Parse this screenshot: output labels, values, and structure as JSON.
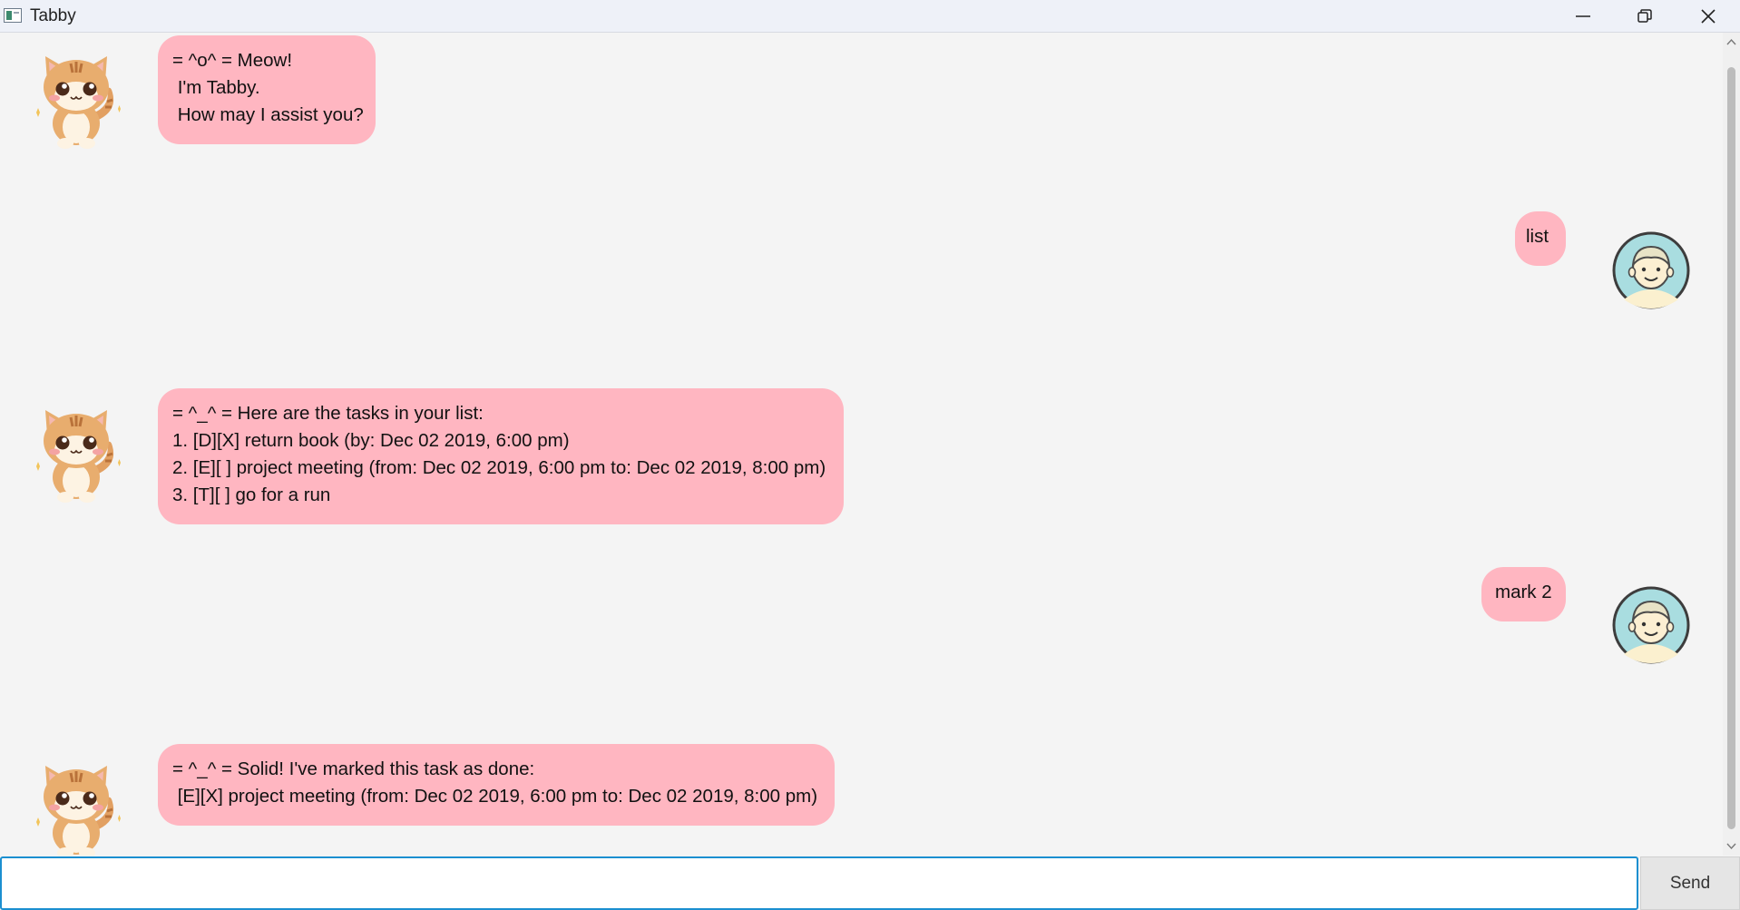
{
  "window": {
    "title": "Tabby",
    "controls": [
      "minimize-icon",
      "restore-icon",
      "close-icon"
    ]
  },
  "messages": [
    {
      "sender": "tabby",
      "avatar": "cat-avatar",
      "text": "= ^o^ = Meow!\n I'm Tabby.\n How may I assist you?"
    },
    {
      "sender": "user",
      "avatar": "user-avatar",
      "text": "list"
    },
    {
      "sender": "tabby",
      "avatar": "cat-avatar",
      "text": "= ^_^ = Here are the tasks in your list:\n1. [D][X] return book (by: Dec 02 2019, 6:00 pm)\n2. [E][ ] project meeting (from: Dec 02 2019, 6:00 pm to: Dec 02 2019, 8:00 pm)\n3. [T][ ] go for a run"
    },
    {
      "sender": "user",
      "avatar": "user-avatar",
      "text": "mark 2"
    },
    {
      "sender": "tabby",
      "avatar": "cat-avatar",
      "text": "= ^_^ = Solid! I've marked this task as done:\n [E][X] project meeting (from: Dec 02 2019, 6:00 pm to: Dec 02 2019, 8:00 pm)"
    }
  ],
  "input": {
    "value": "",
    "placeholder": ""
  },
  "send_label": "Send",
  "colors": {
    "bubble": "#ffb6c1",
    "background": "#f4f4f4",
    "input_border": "#1b8fd0",
    "send_button": "#e5e5e5"
  }
}
